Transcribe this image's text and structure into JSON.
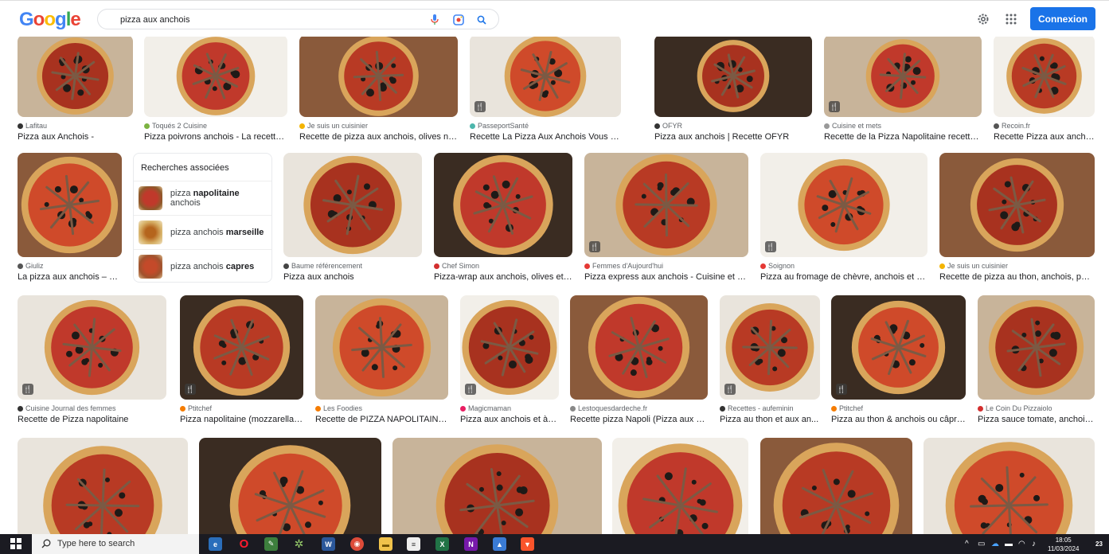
{
  "header": {
    "logo": [
      "G",
      "o",
      "o",
      "g",
      "l",
      "e"
    ],
    "search_value": "pizza aux anchois",
    "login_label": "Connexion"
  },
  "results": [
    {
      "source": "Lafitau",
      "title": "Pizza aux Anchois -",
      "dot": "#333"
    },
    {
      "source": "Toqués 2 Cuisine",
      "title": "Pizza poivrons anchois - La recette ...",
      "dot": "#7cb342"
    },
    {
      "source": "Je suis un cuisinier",
      "title": "Recette de pizza aux anchois, olives noi...",
      "dot": "#f4b400"
    },
    {
      "source": "PasseportSanté",
      "title": "Recette La Pizza Aux Anchois Vous Rappro...",
      "dot": "#4db6ac"
    },
    {
      "source": "OFYR",
      "title": "Pizza aux anchois | Recette OFYR",
      "dot": "#333"
    },
    {
      "source": "Cuisine et mets",
      "title": "Recette de la Pizza Napolitaine recette i...",
      "dot": "#999"
    },
    {
      "source": "Recoin.fr",
      "title": "Recette Pizza aux ancho...",
      "dot": "#555"
    },
    {
      "source": "Giuliz",
      "title": "La pizza aux anchois – G...",
      "dot": "#555"
    },
    {
      "source": "Baume référencement",
      "title": "Pizza aux anchois",
      "dot": "#444"
    },
    {
      "source": "Chef Simon",
      "title": "Pizza-wrap aux anchois, olives et c...",
      "dot": "#d32f2f"
    },
    {
      "source": "Femmes d'Aujourd'hui",
      "title": "Pizza express aux anchois - Cuisine et Re...",
      "dot": "#e53935"
    },
    {
      "source": "Soignon",
      "title": "Pizza au fromage de chèvre, anchois et oli...",
      "dot": "#e53935"
    },
    {
      "source": "Je suis un cuisinier",
      "title": "Recette de pizza au thon, anchois, poiv...",
      "dot": "#f4b400"
    },
    {
      "source": "Cuisine Journal des femmes",
      "title": "Recette de Pizza napolitaine",
      "dot": "#333"
    },
    {
      "source": "Ptitchef",
      "title": "Pizza napolitaine (mozzarella, ...",
      "dot": "#f57c00"
    },
    {
      "source": "Les Foodies",
      "title": "Recette de PIZZA NAPOLITAINE ...",
      "dot": "#f57c00"
    },
    {
      "source": "Magicmaman",
      "title": "Pizza aux anchois et à l...",
      "dot": "#e91e63"
    },
    {
      "source": "Lestoquesdardeche.fr",
      "title": "Recette pizza Napoli (Pizza aux an...",
      "dot": "#888"
    },
    {
      "source": "Recettes - aufeminin",
      "title": "Pizza au thon et aux an...",
      "dot": "#333"
    },
    {
      "source": "Ptitchef",
      "title": "Pizza au thon & anchois ou câpre...",
      "dot": "#f57c00"
    },
    {
      "source": "Le Coin Du Pizzaiolo",
      "title": "Pizza sauce tomate, anchois ...",
      "dot": "#d32f2f"
    }
  ],
  "related": {
    "heading": "Recherches associées",
    "items": [
      {
        "base": "pizza ",
        "bold": "napolitaine",
        "tail": " anchois"
      },
      {
        "base": "pizza anchois ",
        "bold": "marseille",
        "tail": ""
      },
      {
        "base": "pizza anchois ",
        "bold": "capres",
        "tail": ""
      }
    ]
  },
  "taskbar": {
    "search_placeholder": "Type here to search",
    "time": "18:05",
    "date": "11/03/2024",
    "notification_count": "23"
  }
}
